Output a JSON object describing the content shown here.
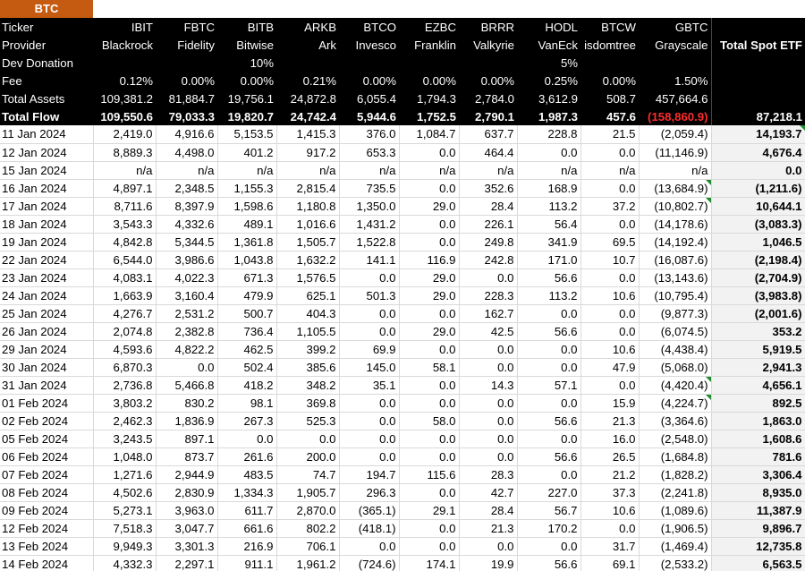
{
  "tag": "BTC",
  "header_rows": [
    {
      "label": "Ticker",
      "cells": [
        "IBIT",
        "FBTC",
        "BITB",
        "ARKB",
        "BTCO",
        "EZBC",
        "BRRR",
        "HODL",
        "BTCW",
        "GBTC",
        ""
      ],
      "bold": false
    },
    {
      "label": "Provider",
      "cells": [
        "Blackrock",
        "Fidelity",
        "Bitwise",
        "Ark",
        "Invesco",
        "Franklin",
        "Valkyrie",
        "VanEck",
        "isdomtree",
        "Grayscale",
        "Total Spot ETF"
      ],
      "bold": false
    },
    {
      "label": "Dev Donation",
      "cells": [
        "",
        "",
        "10%",
        "",
        "",
        "",
        "",
        "5%",
        "",
        "",
        ""
      ],
      "bold": false
    },
    {
      "label": "Fee",
      "cells": [
        "0.12%",
        "0.00%",
        "0.00%",
        "0.21%",
        "0.00%",
        "0.00%",
        "0.00%",
        "0.25%",
        "0.00%",
        "1.50%",
        ""
      ],
      "bold": false
    },
    {
      "label": "Total Assets",
      "cells": [
        "109,381.2",
        "81,884.7",
        "19,756.1",
        "24,872.8",
        "6,055.4",
        "1,794.3",
        "2,784.0",
        "3,612.9",
        "508.7",
        "457,664.6",
        ""
      ],
      "bold": false
    },
    {
      "label": "Total Flow",
      "cells": [
        "109,550.6",
        "79,033.3",
        "19,820.7",
        "24,742.4",
        "5,944.6",
        "1,752.5",
        "2,790.1",
        "1,987.3",
        "457.6",
        "(158,860.9)",
        "87,218.1"
      ],
      "bold": true
    }
  ],
  "rows": [
    {
      "date": "11 Jan 2024",
      "cells": [
        "2,419.0",
        "4,916.6",
        "5,153.5",
        "1,415.3",
        "376.0",
        "1,084.7",
        "637.7",
        "228.8",
        "21.5",
        "(2,059.4)",
        "14,193.7"
      ]
    },
    {
      "date": "12 Jan 2024",
      "cells": [
        "8,889.3",
        "4,498.0",
        "401.2",
        "917.2",
        "653.3",
        "0.0",
        "464.4",
        "0.0",
        "0.0",
        "(11,146.9)",
        "4,676.4"
      ]
    },
    {
      "date": "15 Jan 2024",
      "cells": [
        "n/a",
        "n/a",
        "n/a",
        "n/a",
        "n/a",
        "n/a",
        "n/a",
        "n/a",
        "n/a",
        "n/a",
        "0.0"
      ]
    },
    {
      "date": "16 Jan 2024",
      "cells": [
        "4,897.1",
        "2,348.5",
        "1,155.3",
        "2,815.4",
        "735.5",
        "0.0",
        "352.6",
        "168.9",
        "0.0",
        "(13,684.9)",
        "(1,211.6)"
      ]
    },
    {
      "date": "17 Jan 2024",
      "cells": [
        "8,711.6",
        "8,397.9",
        "1,598.6",
        "1,180.8",
        "1,350.0",
        "29.0",
        "28.4",
        "113.2",
        "37.2",
        "(10,802.7)",
        "10,644.1"
      ]
    },
    {
      "date": "18 Jan 2024",
      "cells": [
        "3,543.3",
        "4,332.6",
        "489.1",
        "1,016.6",
        "1,431.2",
        "0.0",
        "226.1",
        "56.4",
        "0.0",
        "(14,178.6)",
        "(3,083.3)"
      ]
    },
    {
      "date": "19 Jan 2024",
      "cells": [
        "4,842.8",
        "5,344.5",
        "1,361.8",
        "1,505.7",
        "1,522.8",
        "0.0",
        "249.8",
        "341.9",
        "69.5",
        "(14,192.4)",
        "1,046.5"
      ]
    },
    {
      "date": "22 Jan 2024",
      "cells": [
        "6,544.0",
        "3,986.6",
        "1,043.8",
        "1,632.2",
        "141.1",
        "116.9",
        "242.8",
        "171.0",
        "10.7",
        "(16,087.6)",
        "(2,198.4)"
      ]
    },
    {
      "date": "23 Jan 2024",
      "cells": [
        "4,083.1",
        "4,022.3",
        "671.3",
        "1,576.5",
        "0.0",
        "29.0",
        "0.0",
        "56.6",
        "0.0",
        "(13,143.6)",
        "(2,704.9)"
      ]
    },
    {
      "date": "24 Jan 2024",
      "cells": [
        "1,663.9",
        "3,160.4",
        "479.9",
        "625.1",
        "501.3",
        "29.0",
        "228.3",
        "113.2",
        "10.6",
        "(10,795.4)",
        "(3,983.8)"
      ]
    },
    {
      "date": "25 Jan 2024",
      "cells": [
        "4,276.7",
        "2,531.2",
        "500.7",
        "404.3",
        "0.0",
        "0.0",
        "162.7",
        "0.0",
        "0.0",
        "(9,877.3)",
        "(2,001.6)"
      ]
    },
    {
      "date": "26 Jan 2024",
      "cells": [
        "2,074.8",
        "2,382.8",
        "736.4",
        "1,105.5",
        "0.0",
        "29.0",
        "42.5",
        "56.6",
        "0.0",
        "(6,074.5)",
        "353.2"
      ]
    },
    {
      "date": "29 Jan 2024",
      "cells": [
        "4,593.6",
        "4,822.2",
        "462.5",
        "399.2",
        "69.9",
        "0.0",
        "0.0",
        "0.0",
        "10.6",
        "(4,438.4)",
        "5,919.5"
      ]
    },
    {
      "date": "30 Jan 2024",
      "cells": [
        "6,870.3",
        "0.0",
        "502.4",
        "385.6",
        "145.0",
        "58.1",
        "0.0",
        "0.0",
        "47.9",
        "(5,068.0)",
        "2,941.3"
      ]
    },
    {
      "date": "31 Jan 2024",
      "cells": [
        "2,736.8",
        "5,466.8",
        "418.2",
        "348.2",
        "35.1",
        "0.0",
        "14.3",
        "57.1",
        "0.0",
        "(4,420.4)",
        "4,656.1"
      ]
    },
    {
      "date": "01 Feb 2024",
      "cells": [
        "3,803.2",
        "830.2",
        "98.1",
        "369.8",
        "0.0",
        "0.0",
        "0.0",
        "0.0",
        "15.9",
        "(4,224.7)",
        "892.5"
      ]
    },
    {
      "date": "02 Feb 2024",
      "cells": [
        "2,462.3",
        "1,836.9",
        "267.3",
        "525.3",
        "0.0",
        "58.0",
        "0.0",
        "56.6",
        "21.3",
        "(3,364.6)",
        "1,863.0"
      ]
    },
    {
      "date": "05 Feb 2024",
      "cells": [
        "3,243.5",
        "897.1",
        "0.0",
        "0.0",
        "0.0",
        "0.0",
        "0.0",
        "0.0",
        "16.0",
        "(2,548.0)",
        "1,608.6"
      ]
    },
    {
      "date": "06 Feb 2024",
      "cells": [
        "1,048.0",
        "873.7",
        "261.6",
        "200.0",
        "0.0",
        "0.0",
        "0.0",
        "56.6",
        "26.5",
        "(1,684.8)",
        "781.6"
      ]
    },
    {
      "date": "07 Feb 2024",
      "cells": [
        "1,271.6",
        "2,944.9",
        "483.5",
        "74.7",
        "194.7",
        "115.6",
        "28.3",
        "0.0",
        "21.2",
        "(1,828.2)",
        "3,306.4"
      ]
    },
    {
      "date": "08 Feb 2024",
      "cells": [
        "4,502.6",
        "2,830.9",
        "1,334.3",
        "1,905.7",
        "296.3",
        "0.0",
        "42.7",
        "227.0",
        "37.3",
        "(2,241.8)",
        "8,935.0"
      ]
    },
    {
      "date": "09 Feb 2024",
      "cells": [
        "5,273.1",
        "3,963.0",
        "611.7",
        "2,870.0",
        "(365.1)",
        "29.1",
        "28.4",
        "56.7",
        "10.6",
        "(1,089.6)",
        "11,387.9"
      ]
    },
    {
      "date": "12 Feb 2024",
      "cells": [
        "7,518.3",
        "3,047.7",
        "661.6",
        "802.2",
        "(418.1)",
        "0.0",
        "21.3",
        "170.2",
        "0.0",
        "(1,906.5)",
        "9,896.7"
      ]
    },
    {
      "date": "13 Feb 2024",
      "cells": [
        "9,949.3",
        "3,301.3",
        "216.9",
        "706.1",
        "0.0",
        "0.0",
        "0.0",
        "0.0",
        "31.7",
        "(1,469.4)",
        "12,735.8"
      ]
    },
    {
      "date": "14 Feb 2024",
      "cells": [
        "4,332.3",
        "2,297.1",
        "911.1",
        "1,961.2",
        "(724.6)",
        "174.1",
        "19.9",
        "56.6",
        "69.1",
        "(2,533.2)",
        "6,563.5"
      ]
    }
  ],
  "flagged_cells": [
    {
      "row": 0,
      "col": 10
    },
    {
      "row": 3,
      "col": 9
    },
    {
      "row": 4,
      "col": 9
    },
    {
      "row": 14,
      "col": 9
    },
    {
      "row": 15,
      "col": 9
    }
  ],
  "colors": {
    "tag_bg": "#c55a11",
    "header_bg": "#000000",
    "negative": "#e00000",
    "total_col_bg": "#f2f2f2",
    "comment_flag": "#1e8b2f"
  }
}
